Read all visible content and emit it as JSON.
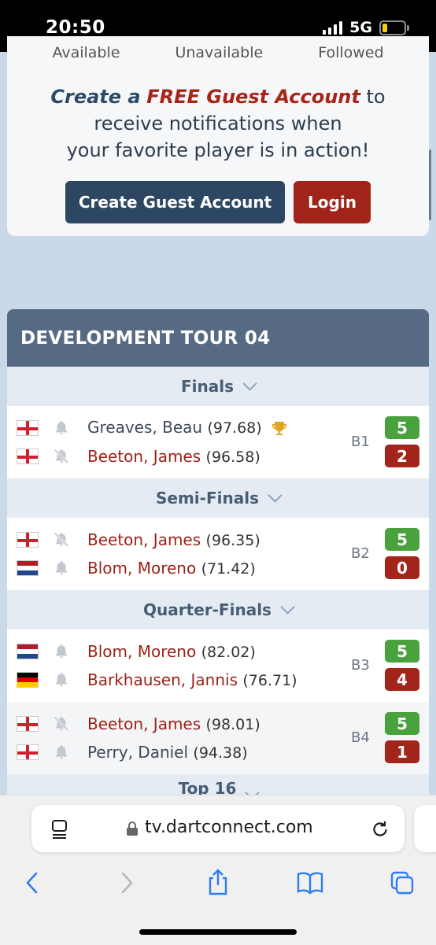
{
  "status_bar": {
    "time": "20:50",
    "network": "5G"
  },
  "promo": {
    "cutoff_labels": [
      "Available",
      "Unavailable",
      "Followed"
    ],
    "line1_create": "Create a",
    "line1_free": "FREE Guest Account",
    "line1_to": "to",
    "line2": "receive notifications when",
    "line3": "your favorite player is in action!",
    "guest_button": "Create Guest Account",
    "login_button": "Login"
  },
  "tournament": {
    "title": "DEVELOPMENT TOUR 04",
    "rounds": [
      {
        "name": "Finals",
        "matches": [
          {
            "board": "B1",
            "p1": {
              "flag": "england",
              "bell": "bell-icon",
              "name": "Greaves, Beau",
              "avg": "(97.68)",
              "score": "5",
              "trophy": true
            },
            "p2": {
              "flag": "england",
              "bell": "bell-off-icon",
              "name": "Beeton, James",
              "avg": "(96.58)",
              "score": "2"
            }
          }
        ]
      },
      {
        "name": "Semi-Finals",
        "matches": [
          {
            "board": "B2",
            "p1": {
              "flag": "england",
              "bell": "bell-off-icon",
              "name": "Beeton, James",
              "avg": "(96.35)",
              "score": "5"
            },
            "p2": {
              "flag": "netherlands",
              "bell": "bell-icon",
              "name": "Blom, Moreno",
              "avg": "(71.42)",
              "score": "0"
            }
          }
        ]
      },
      {
        "name": "Quarter-Finals",
        "matches": [
          {
            "board": "B3",
            "p1": {
              "flag": "netherlands",
              "bell": "bell-icon",
              "name": "Blom, Moreno",
              "avg": "(82.02)",
              "score": "5"
            },
            "p2": {
              "flag": "germany",
              "bell": "bell-icon",
              "name": "Barkhausen, Jannis",
              "avg": "(76.71)",
              "score": "4"
            }
          },
          {
            "board": "B4",
            "p1": {
              "flag": "england",
              "bell": "bell-off-icon",
              "name": "Beeton, James",
              "avg": "(98.01)",
              "score": "5"
            },
            "p2": {
              "flag": "england",
              "bell": "bell-icon",
              "name": "Perry, Daniel",
              "avg": "(94.38)",
              "score": "1"
            }
          }
        ]
      },
      {
        "name": "Top 16"
      }
    ]
  },
  "browser": {
    "url": "tv.dartconnect.com"
  },
  "colors": {
    "win": "#4aa23f",
    "lose": "#a3241a",
    "header": "#566b83",
    "brand_red": "#a1241a",
    "brand_navy": "#2d4661"
  }
}
